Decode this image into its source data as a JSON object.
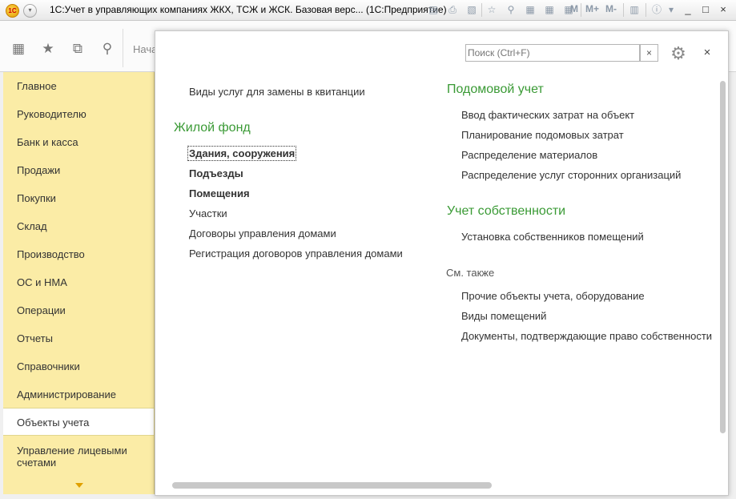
{
  "window": {
    "title": "1С:Учет в управляющих компаниях ЖКХ, ТСЖ и ЖСК. Базовая верс...  (1С:Предприятие)",
    "logo_text": "1С",
    "toolbar_text_items": [
      "M",
      "M+",
      "M-"
    ],
    "controls": [
      "_",
      "□",
      "×"
    ]
  },
  "section_strip": {
    "icons": [
      "apps-grid-icon",
      "star-icon",
      "history-icon",
      "search-icon"
    ],
    "home_tab_label": "Нача"
  },
  "nav": {
    "items": [
      {
        "label": "Главное"
      },
      {
        "label": "Руководителю"
      },
      {
        "label": "Банк и касса"
      },
      {
        "label": "Продажи"
      },
      {
        "label": "Покупки"
      },
      {
        "label": "Склад"
      },
      {
        "label": "Производство"
      },
      {
        "label": "ОС и НМА"
      },
      {
        "label": "Операции"
      },
      {
        "label": "Отчеты"
      },
      {
        "label": "Справочники"
      },
      {
        "label": "Администрирование"
      },
      {
        "label": "Объекты учета",
        "active": true
      },
      {
        "label": "Управление лицевыми счетами"
      }
    ]
  },
  "content": {
    "search": {
      "placeholder": "Поиск (Ctrl+F)",
      "clear_label": "×"
    },
    "close_label": "×",
    "left_column": {
      "top_link": "Виды услуг для замены в квитанции",
      "group_title": "Жилой фонд",
      "links": [
        {
          "label": "Здания, сооружения",
          "bold": true,
          "focused": true
        },
        {
          "label": "Подъезды",
          "bold": true
        },
        {
          "label": "Помещения",
          "bold": true
        },
        {
          "label": "Участки"
        },
        {
          "label": "Договоры управления домами"
        },
        {
          "label": "Регистрация договоров управления домами"
        }
      ]
    },
    "right_column": {
      "groups": [
        {
          "title": "Подомовой учет",
          "links": [
            "Ввод фактических затрат на объект",
            "Планирование подомовых затрат",
            "Распределение материалов",
            "Распределение услуг сторонних организаций"
          ]
        },
        {
          "title": "Учет собственности",
          "links": [
            "Установка собственников помещений"
          ]
        }
      ],
      "see_also_title": "См. также",
      "see_also_links": [
        "Прочие объекты учета, оборудование",
        "Виды помещений",
        "Документы, подтверждающие право собственности"
      ]
    }
  },
  "colors": {
    "nav_background": "#fbeca6",
    "group_title": "#3a9a35",
    "accent_yellow": "#e0a000"
  }
}
